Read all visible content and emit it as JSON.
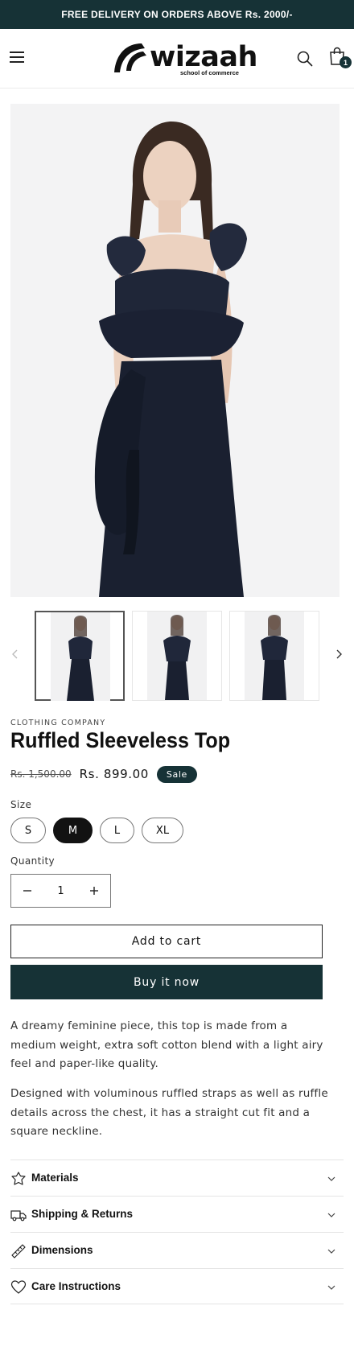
{
  "announcement": "FREE DELIVERY ON ORDERS ABOVE Rs. 2000/-",
  "header": {
    "logo_text": "wizaah",
    "logo_tagline": "school of commerce",
    "cart_count": "1"
  },
  "product": {
    "vendor": "CLOTHING COMPANY",
    "title": "Ruffled Sleeveless Top",
    "regular_price": "Rs. 1,500.00",
    "sale_price": "Rs. 899.00",
    "sale_badge": "Sale",
    "size_label": "Size",
    "sizes": [
      "S",
      "M",
      "L",
      "XL"
    ],
    "selected_size": "M",
    "quantity_label": "Quantity",
    "quantity": "1",
    "add_to_cart": "Add to cart",
    "buy_now": "Buy it now",
    "description": [
      "A dreamy feminine piece, this top is made from a medium weight, extra soft cotton blend with a light airy feel and paper-like quality.",
      "Designed with voluminous ruffled straps as well as ruffle details across the chest, it has a straight cut fit and a square neckline."
    ]
  },
  "accordion": [
    {
      "label": "Materials",
      "icon": "leaf-icon"
    },
    {
      "label": "Shipping & Returns",
      "icon": "truck-icon"
    },
    {
      "label": "Dimensions",
      "icon": "ruler-icon"
    },
    {
      "label": "Care Instructions",
      "icon": "heart-icon"
    }
  ],
  "colors": {
    "brand": "#163236",
    "text": "#121212",
    "dress": "#1c2233"
  }
}
